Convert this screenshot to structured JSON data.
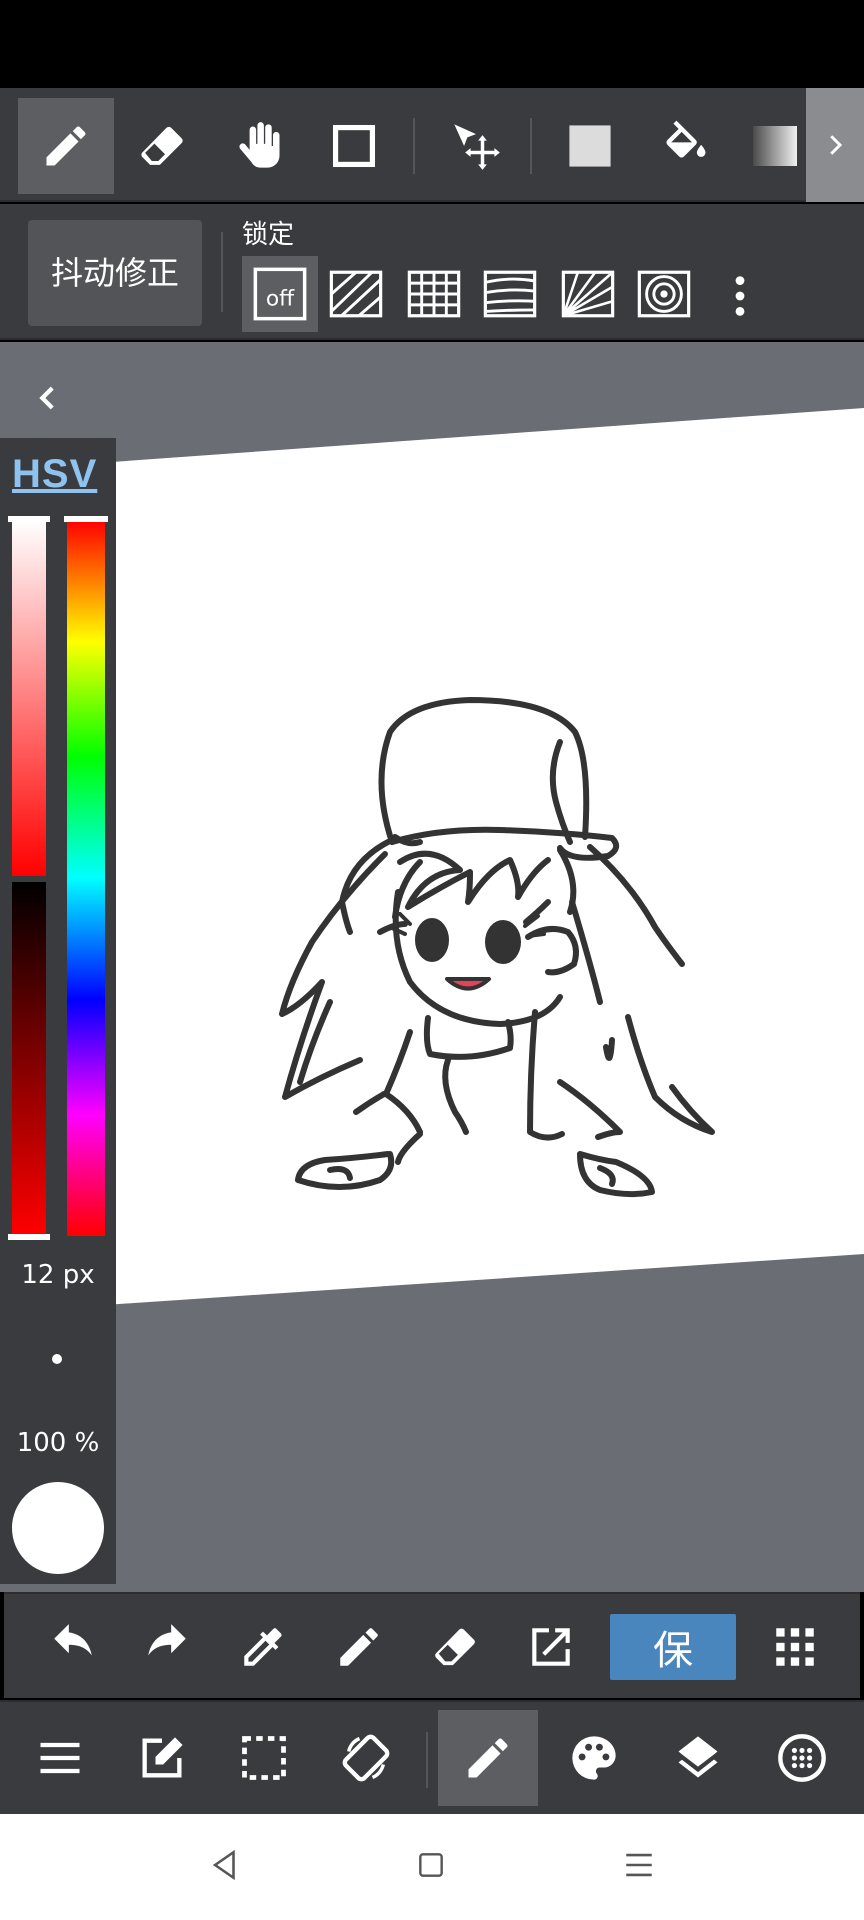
{
  "toolbar": {
    "tools": [
      {
        "id": "pen",
        "icon": "pen-icon",
        "selected": true
      },
      {
        "id": "eraser",
        "icon": "eraser-icon"
      },
      {
        "id": "hand",
        "icon": "hand-icon"
      },
      {
        "id": "shape",
        "icon": "rectangle-icon"
      },
      {
        "id": "move",
        "icon": "move-cursor-icon"
      },
      {
        "id": "fill-rect",
        "icon": "fill-rectangle-icon"
      },
      {
        "id": "bucket",
        "icon": "paint-bucket-icon"
      },
      {
        "id": "gradient",
        "icon": "gradient-icon"
      }
    ],
    "more": "chevron-right-icon"
  },
  "stabilizer": {
    "label": "抖动修正"
  },
  "lock": {
    "label": "锁定",
    "off_label": "off",
    "options": [
      "off",
      "parallel-lines",
      "grid",
      "perspective-curve",
      "radial-lines",
      "concentric-circles"
    ]
  },
  "color_panel": {
    "mode_label": "HSV",
    "brush_size": "12 px",
    "opacity": "100 %",
    "current_color": "#ffffff"
  },
  "actions": {
    "save_label": "保"
  },
  "colors": {
    "toolbar_bg": "#3a3b3e",
    "selected_bg": "#5d5e61",
    "canvas_bg": "#6a6d73",
    "save_blue": "#4a86be",
    "hsv_blue": "#8fc3ef"
  }
}
